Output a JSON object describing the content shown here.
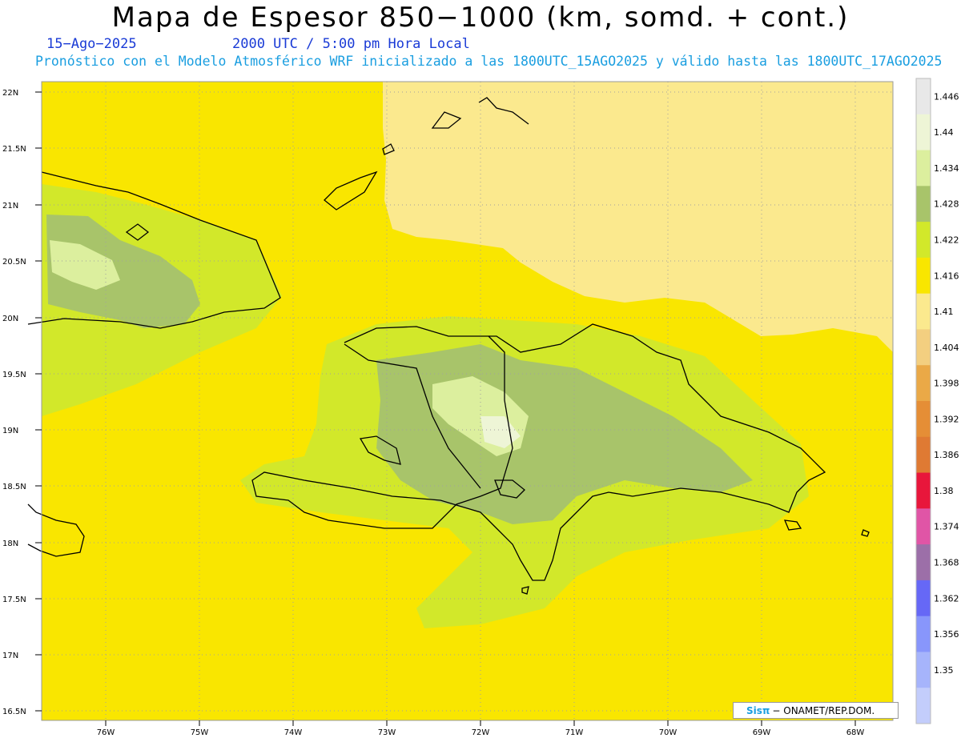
{
  "title": "Mapa de Espesor 850−1000 (km, somd. + cont.)",
  "date": "15−Ago−2025",
  "time": "2000 UTC / 5:00 pm Hora Local",
  "info": "Pronóstico con el Modelo Atmosférico WRF inicializado a las 1800UTC_15AGO2025 y válido hasta las  1800UTC_17AGO2025",
  "credit": {
    "logo": "Sisπ",
    "text": "− ONAMET/REP.DOM."
  },
  "lat_labels": [
    "22N",
    "21.5N",
    "21N",
    "20.5N",
    "20N",
    "19.5N",
    "19N",
    "18.5N",
    "18N",
    "17.5N",
    "17N",
    "16.5N"
  ],
  "lon_labels": [
    "76W",
    "75W",
    "74W",
    "73W",
    "72W",
    "71W",
    "70W",
    "69W",
    "68W"
  ],
  "colorbar": {
    "levels": [
      "1.446",
      "1.44",
      "1.434",
      "1.428",
      "1.422",
      "1.416",
      "1.41",
      "1.404",
      "1.398",
      "1.392",
      "1.386",
      "1.38",
      "1.374",
      "1.368",
      "1.362",
      "1.356",
      "1.35"
    ],
    "colors": [
      "#e8e8e8",
      "#eef5d6",
      "#dcef9e",
      "#a8c46a",
      "#d2e82a",
      "#f9e600",
      "#fbe98e",
      "#f3cf80",
      "#eaa947",
      "#e58e36",
      "#df7a33",
      "#e8163b",
      "#e055a6",
      "#9c6fa8",
      "#6668f6",
      "#8896fb",
      "#a6b4fb",
      "#c3cdfb"
    ]
  },
  "colors": {
    "dominant": "#f9e600",
    "north_ocean": "#fbe98e"
  }
}
